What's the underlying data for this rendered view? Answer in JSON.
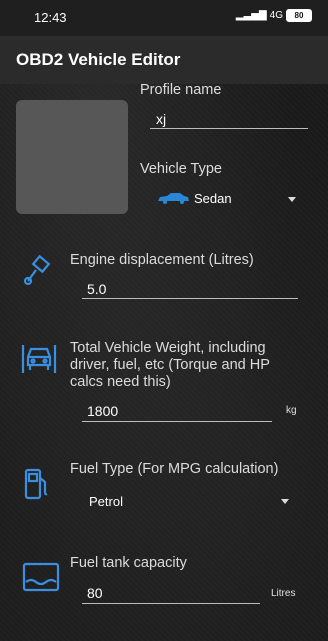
{
  "status": {
    "time": "12:43",
    "network": "4G",
    "battery": "80"
  },
  "app": {
    "title": "OBD2 Vehicle Editor"
  },
  "profile": {
    "label": "Profile name",
    "value": "xj"
  },
  "vehicle_type": {
    "label": "Vehicle Type",
    "value": "Sedan"
  },
  "engine": {
    "label": "Engine displacement (Litres)",
    "value": "5.0"
  },
  "weight": {
    "label_line1": "Total Vehicle Weight, including",
    "label_line2": "driver, fuel, etc (Torque and HP",
    "label_line3": "calcs need this)",
    "value": "1800",
    "unit": "kg"
  },
  "fuel_type": {
    "label": "Fuel Type (For MPG calculation)",
    "value": "Petrol"
  },
  "tank": {
    "label": "Fuel tank capacity",
    "value": "80",
    "unit": "Litres"
  },
  "colors": {
    "accent": "#2a86d6",
    "icon": "#3a8fe0"
  }
}
